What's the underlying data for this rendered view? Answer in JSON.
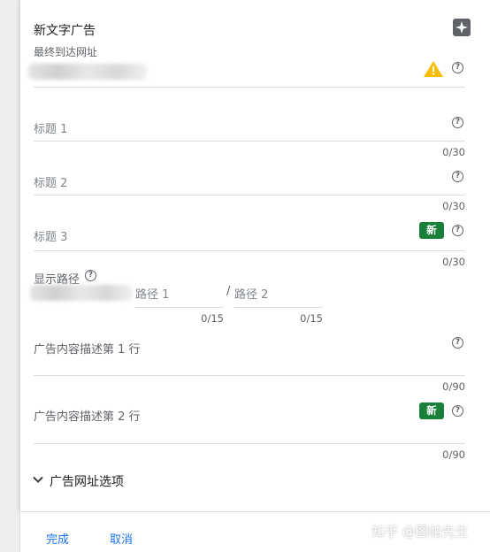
{
  "header": {
    "title": "新文字广告",
    "final_url_label": "最终到达网址"
  },
  "fields": {
    "headline1": {
      "label": "标题 1",
      "counter": "0/30"
    },
    "headline2": {
      "label": "标题 2",
      "counter": "0/30"
    },
    "headline3": {
      "label": "标题 3",
      "counter": "0/30",
      "badge": "新"
    },
    "display_path": {
      "label": "显示路径",
      "path1": {
        "placeholder": "路径 1",
        "counter": "0/15"
      },
      "separator": "/",
      "path2": {
        "placeholder": "路径 2",
        "counter": "0/15"
      }
    },
    "description1": {
      "label": "广告内容描述第 1 行",
      "counter": "0/90"
    },
    "description2": {
      "label": "广告内容描述第 2 行",
      "counter": "0/90",
      "badge": "新"
    }
  },
  "url_options": {
    "label": "广告网址选项"
  },
  "footer": {
    "done": "完成",
    "cancel": "取消"
  },
  "watermark": "知乎 @图帕先生",
  "colors": {
    "accent": "#1a73e8",
    "badge": "#188038",
    "warning": "#fbbc04"
  },
  "icons": [
    "sparkle-icon",
    "warning-icon",
    "help-icon",
    "chevron-down-icon"
  ]
}
